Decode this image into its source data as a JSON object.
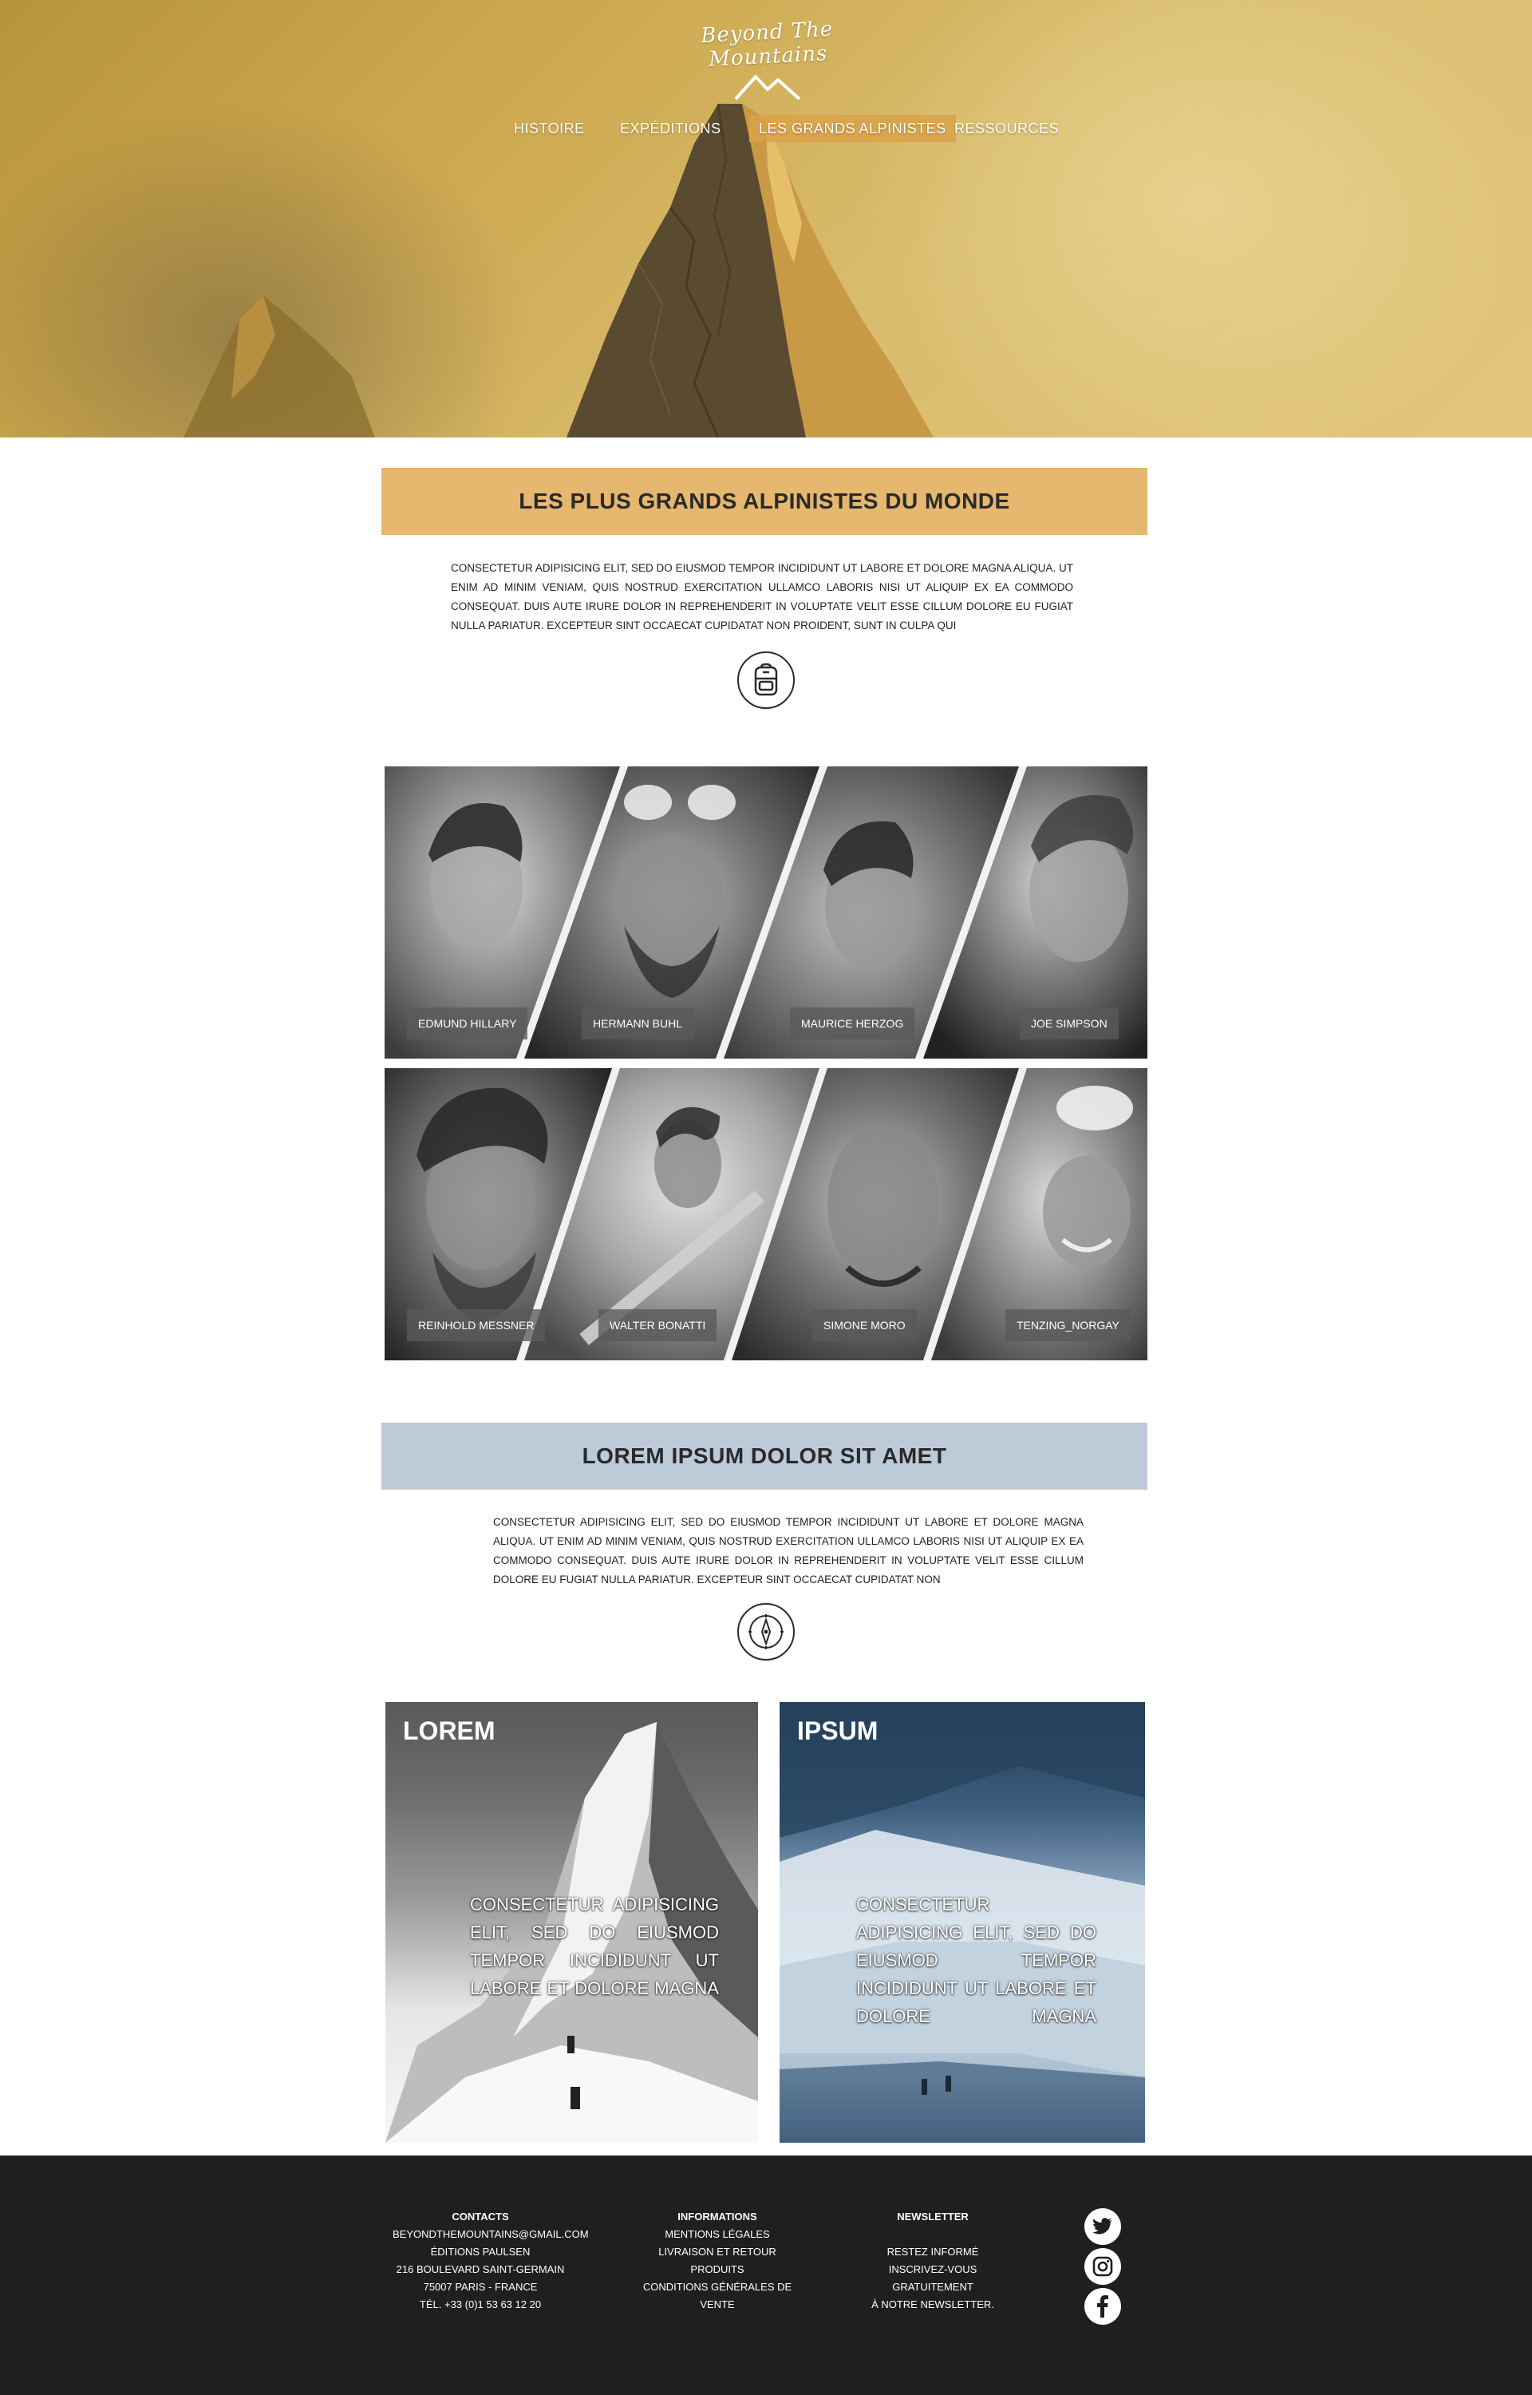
{
  "logo": {
    "text": "Beyond The Mountains"
  },
  "nav": {
    "items": [
      {
        "label": "HISTOIRE"
      },
      {
        "label": "EXPÉDITIONS"
      },
      {
        "label": "LES GRANDS ALPINISTES"
      },
      {
        "label": "RESSOURCES"
      }
    ]
  },
  "section1": {
    "title": "LES PLUS GRANDS ALPINISTES DU MONDE",
    "text": "CONSECTETUR ADIPISICING ELIT, SED DO EIUSMOD TEMPOR INCIDIDUNT UT LABORE ET DOLORE MAGNA ALIQUA. UT ENIM AD MINIM VENIAM, QUIS NOSTRUD EXERCITATION ULLAMCO LABORIS NISI UT ALIQUIP EX EA COMMODO CONSEQUAT. DUIS AUTE IRURE DOLOR IN REPREHENDERIT IN VOLUPTATE VELIT ESSE CILLUM DOLORE EU FUGIAT NULLA PARIATUR. EXCEPTEUR SINT OCCAECAT CUPIDATAT NON PROIDENT, SUNT IN CULPA QUI",
    "icon": "backpack-icon"
  },
  "climbers": {
    "row1": [
      "EDMUND HILLARY",
      "HERMANN BUHL",
      "MAURICE HERZOG",
      "JOE SIMPSON"
    ],
    "row2": [
      "REINHOLD MESSNER",
      "WALTER BONATTI",
      "SIMONE MORO",
      "TENZING_NORGAY"
    ]
  },
  "section2": {
    "title": "LOREM IPSUM DOLOR SIT AMET",
    "text": "CONSECTETUR ADIPISICING ELIT, SED DO EIUSMOD TEMPOR INCIDIDUNT UT LABORE ET DOLORE MAGNA ALIQUA. UT ENIM AD MINIM VENIAM, QUIS NOSTRUD EXERCITATION ULLAMCO LABORIS NISI UT ALIQUIP EX EA COMMODO CONSEQUAT. DUIS AUTE IRURE DOLOR IN REPREHENDERIT IN VOLUPTATE VELIT ESSE CILLUM DOLORE EU FUGIAT NULLA PARIATUR. EXCEPTEUR SINT OCCAECAT CUPIDATAT NON",
    "icon": "compass-icon"
  },
  "cards": [
    {
      "title": "LOREM",
      "text": "CONSECTETUR ADIPISICING ELIT, SED DO EIUSMOD TEMPOR INCIDIDUNT UT LABORE ET DOLORE MAGNA"
    },
    {
      "title": "IPSUM",
      "text": "CONSECTETUR ADIPISICING ELIT, SED DO EIUSMOD TEMPOR INCIDIDUNT UT LABORE ET DOLORE MAGNA"
    }
  ],
  "footer": {
    "contacts": {
      "title": "CONTACTS",
      "lines": [
        "BEYONDTHEMOUNTAINS@GMAIL.COM",
        "ÉDITIONS PAULSEN",
        "216 BOULEVARD SAINT-GERMAIN",
        "75007 PARIS - FRANCE",
        "TÉL. +33 (0)1 53 63 12 20"
      ]
    },
    "informations": {
      "title": "INFORMATIONS",
      "lines": [
        "MENTIONS LÉGALES",
        "LIVRAISON ET RETOUR PRODUITS",
        "CONDITIONS GÉNÉRALES DE VENTE"
      ]
    },
    "newsletter": {
      "title": "NEWSLETTER",
      "lines": [
        "RESTEZ INFORMÉ",
        "INSCRIVEZ-VOUS GRATUITEMENT",
        "À NOTRE NEWSLETTER."
      ]
    },
    "social": [
      "twitter-icon",
      "instagram-icon",
      "facebook-icon"
    ]
  },
  "colors": {
    "banner1": "#e6b76f",
    "banner2": "#bccbd7",
    "footer": "#1f1f1f",
    "nav_active": "#daa248"
  }
}
